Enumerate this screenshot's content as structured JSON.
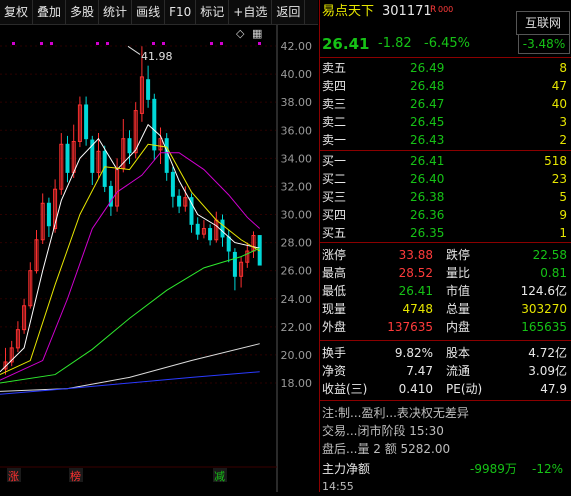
{
  "toolbar": [
    "复权",
    "叠加",
    "多股",
    "统计",
    "画线",
    "F10",
    "标记",
    "+自选",
    "返回"
  ],
  "chart": {
    "price_labels": [
      "42.00",
      "40.00",
      "38.00",
      "36.00",
      "34.00",
      "32.00",
      "30.00",
      "28.00",
      "26.00",
      "24.00",
      "22.00",
      "20.00",
      "18.00"
    ],
    "max_label": "41.98",
    "markers": [
      "涨",
      "榜",
      "减"
    ],
    "icons": {
      "diamond": "◇",
      "grid": "▦"
    }
  },
  "stock": {
    "name": "易点天下",
    "code": "301171",
    "tag": "R",
    "tag2": "000",
    "price": "26.41",
    "change": "-1.82",
    "pct": "-6.45%",
    "sector_name": "互联网",
    "sector_pct": "-3.48%"
  },
  "asks": [
    {
      "label": "卖五",
      "price": "26.49",
      "vol": "8"
    },
    {
      "label": "卖四",
      "price": "26.48",
      "vol": "47"
    },
    {
      "label": "卖三",
      "price": "26.47",
      "vol": "40"
    },
    {
      "label": "卖二",
      "price": "26.45",
      "vol": "3"
    },
    {
      "label": "卖一",
      "price": "26.43",
      "vol": "2"
    }
  ],
  "bids": [
    {
      "label": "买一",
      "price": "26.41",
      "vol": "518"
    },
    {
      "label": "买二",
      "price": "26.40",
      "vol": "23"
    },
    {
      "label": "买三",
      "price": "26.38",
      "vol": "5"
    },
    {
      "label": "买四",
      "price": "26.36",
      "vol": "9"
    },
    {
      "label": "买五",
      "price": "26.35",
      "vol": "1"
    }
  ],
  "stats": {
    "zt_label": "涨停",
    "zt": "33.88",
    "dt_label": "跌停",
    "dt": "22.58",
    "high_label": "最高",
    "high": "28.52",
    "lb_label": "量比",
    "lb": "0.81",
    "low_label": "最低",
    "low": "26.41",
    "sz_label": "市值",
    "sz": "124.6亿",
    "xl_label": "现量",
    "xl": "4748",
    "zl_label": "总量",
    "zl": "303270",
    "wp_label": "外盘",
    "wp": "137635",
    "np_label": "内盘",
    "np": "165635",
    "hs_label": "换手",
    "hs": "9.82%",
    "gb_label": "股本",
    "gb": "4.72亿",
    "jz_label": "净资",
    "jz": "7.47",
    "lt_label": "流通",
    "lt": "3.09亿",
    "sy_label": "收益(三)",
    "sy": "0.410",
    "pe_label": "PE(动)",
    "pe": "47.9"
  },
  "notes": {
    "line1": "注:制...盈利...表决权无差异",
    "line2": "交易...闭市阶段 15:30",
    "line3": "盘后...量 2   额 5282.00",
    "flow_label": "主力净额",
    "flow_val": "-9989万",
    "flow_pct": "-12%",
    "bottom": "14:55"
  }
}
